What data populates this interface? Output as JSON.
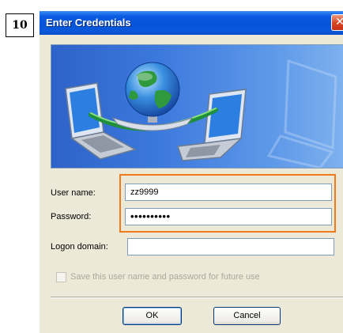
{
  "step_number": "10",
  "window": {
    "title": "Enter Credentials",
    "close_glyph": "✕"
  },
  "banner": {
    "icon": "network-globe-laptops-illustration"
  },
  "form": {
    "username_label": "User name:",
    "username_value": "zz9999",
    "password_label": "Password:",
    "password_value": "••••••••••",
    "domain_label": "Logon domain:",
    "domain_value": "",
    "save_checkbox_label": "Save this user name and password for future use",
    "save_checked": false
  },
  "buttons": {
    "ok": "OK",
    "cancel": "Cancel"
  },
  "colors": {
    "title_bar": "#0553d6",
    "highlight": "#ee7a1a",
    "banner": "#3b78dc",
    "dialog_bg": "#ece9d8"
  }
}
